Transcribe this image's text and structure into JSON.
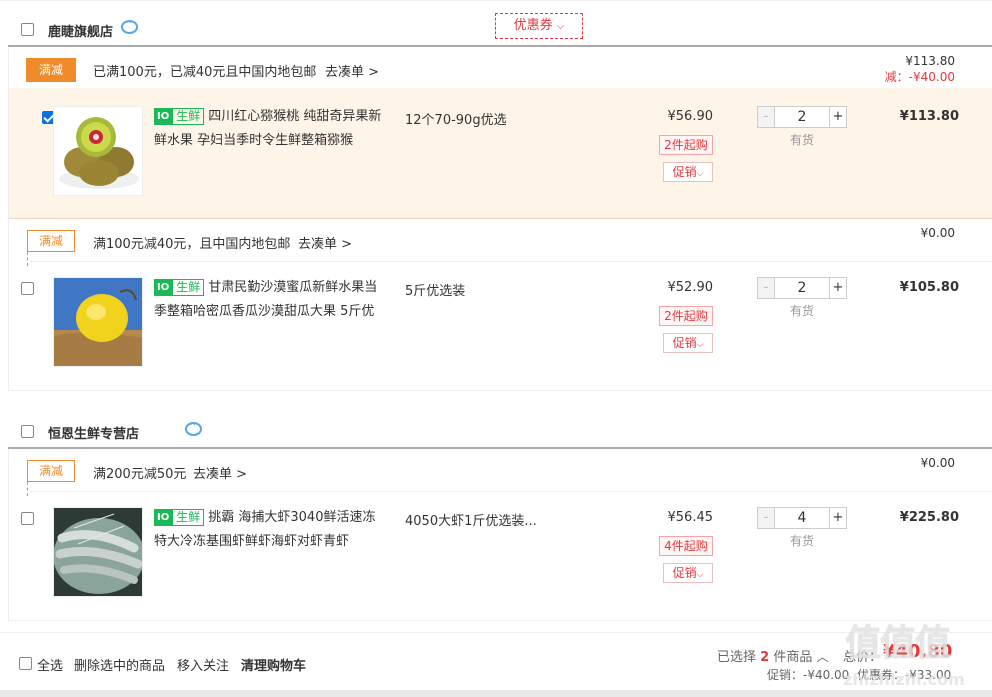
{
  "shops": [
    {
      "name": "鹿睫旗舰店",
      "coupon_label": "优惠券",
      "promotion": {
        "tag": "满减",
        "text": "已满100元，已减40元且中国内地包邮",
        "link": "去凑单 >",
        "subtotal": "¥113.80",
        "discount": "减：-¥40.00"
      },
      "item": {
        "checked": true,
        "badge_a": "IO",
        "badge_b": "生鲜",
        "title": "四川红心猕猴桃 纯甜奇异果新鲜水果 孕妇当季时令生鲜整箱猕猴",
        "spec": "12个70-90g优选",
        "price": "¥56.90",
        "min_buy": "2件起购",
        "promo_btn": "促销",
        "qty": "2",
        "stock": "有货",
        "total": "¥113.80"
      }
    },
    {
      "promotion": {
        "tag": "满减",
        "text": "满100元减40元，且中国内地包邮",
        "link": "去凑单 >",
        "subtotal": "¥0.00"
      },
      "item": {
        "checked": false,
        "badge_a": "IO",
        "badge_b": "生鲜",
        "title": "甘肃民勤沙漠蜜瓜新鲜水果当季整箱哈密瓜香瓜沙漠甜瓜大果 5斤优",
        "spec": "5斤优选装",
        "price": "¥52.90",
        "min_buy": "2件起购",
        "promo_btn": "促销",
        "qty": "2",
        "stock": "有货",
        "total": "¥105.80"
      }
    },
    {
      "name": "恒恩生鲜专营店",
      "promotion": {
        "tag": "满减",
        "text": "满200元减50元",
        "link": "去凑单 >",
        "subtotal": "¥0.00"
      },
      "item": {
        "checked": false,
        "badge_a": "IO",
        "badge_b": "生鲜",
        "title": "挑霸 海捕大虾3040鲜活速冻特大冷冻基围虾鲜虾海虾对虾青虾",
        "spec": "4050大虾1斤优选装...",
        "price": "¥56.45",
        "min_buy": "4件起购",
        "promo_btn": "促销",
        "qty": "4",
        "stock": "有货",
        "total": "¥225.80"
      }
    }
  ],
  "footer": {
    "select_all": "全选",
    "delete_selected": "删除选中的商品",
    "move_to_follow": "移入关注",
    "clear_cart": "清理购物车",
    "selected_prefix": "已选择",
    "selected_count": "2",
    "selected_suffix": "件商品",
    "total_label": "总价：",
    "total_value": "¥40.80",
    "promo_line": "促销：-¥40.00  优惠券：-¥33.00"
  },
  "watermark": {
    "logo": "值值值",
    "url": "zhizhizhi.com"
  },
  "colors": {
    "accent": "#e4393c",
    "orange": "#f08b2c",
    "green": "#19b955",
    "selected_bg": "#fff4e8"
  }
}
